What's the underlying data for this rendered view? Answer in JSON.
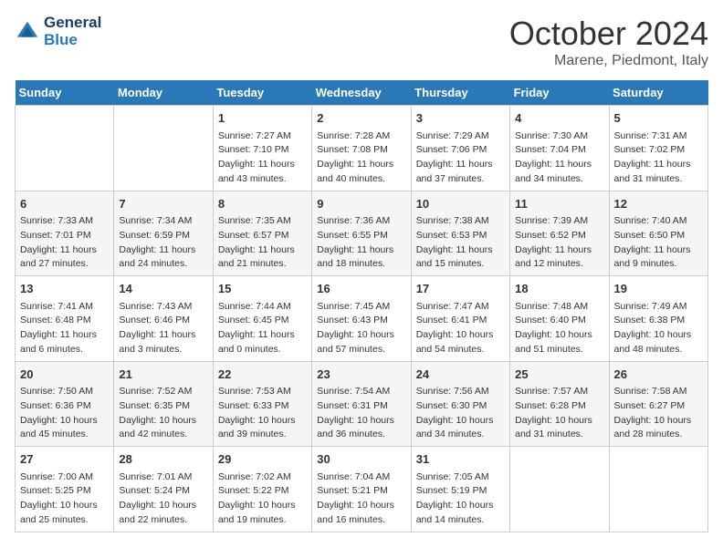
{
  "header": {
    "logo_line1": "General",
    "logo_line2": "Blue",
    "month": "October 2024",
    "location": "Marene, Piedmont, Italy"
  },
  "days_of_week": [
    "Sunday",
    "Monday",
    "Tuesday",
    "Wednesday",
    "Thursday",
    "Friday",
    "Saturday"
  ],
  "weeks": [
    [
      {
        "day": "",
        "info": ""
      },
      {
        "day": "",
        "info": ""
      },
      {
        "day": "1",
        "info": "Sunrise: 7:27 AM\nSunset: 7:10 PM\nDaylight: 11 hours and 43 minutes."
      },
      {
        "day": "2",
        "info": "Sunrise: 7:28 AM\nSunset: 7:08 PM\nDaylight: 11 hours and 40 minutes."
      },
      {
        "day": "3",
        "info": "Sunrise: 7:29 AM\nSunset: 7:06 PM\nDaylight: 11 hours and 37 minutes."
      },
      {
        "day": "4",
        "info": "Sunrise: 7:30 AM\nSunset: 7:04 PM\nDaylight: 11 hours and 34 minutes."
      },
      {
        "day": "5",
        "info": "Sunrise: 7:31 AM\nSunset: 7:02 PM\nDaylight: 11 hours and 31 minutes."
      }
    ],
    [
      {
        "day": "6",
        "info": "Sunrise: 7:33 AM\nSunset: 7:01 PM\nDaylight: 11 hours and 27 minutes."
      },
      {
        "day": "7",
        "info": "Sunrise: 7:34 AM\nSunset: 6:59 PM\nDaylight: 11 hours and 24 minutes."
      },
      {
        "day": "8",
        "info": "Sunrise: 7:35 AM\nSunset: 6:57 PM\nDaylight: 11 hours and 21 minutes."
      },
      {
        "day": "9",
        "info": "Sunrise: 7:36 AM\nSunset: 6:55 PM\nDaylight: 11 hours and 18 minutes."
      },
      {
        "day": "10",
        "info": "Sunrise: 7:38 AM\nSunset: 6:53 PM\nDaylight: 11 hours and 15 minutes."
      },
      {
        "day": "11",
        "info": "Sunrise: 7:39 AM\nSunset: 6:52 PM\nDaylight: 11 hours and 12 minutes."
      },
      {
        "day": "12",
        "info": "Sunrise: 7:40 AM\nSunset: 6:50 PM\nDaylight: 11 hours and 9 minutes."
      }
    ],
    [
      {
        "day": "13",
        "info": "Sunrise: 7:41 AM\nSunset: 6:48 PM\nDaylight: 11 hours and 6 minutes."
      },
      {
        "day": "14",
        "info": "Sunrise: 7:43 AM\nSunset: 6:46 PM\nDaylight: 11 hours and 3 minutes."
      },
      {
        "day": "15",
        "info": "Sunrise: 7:44 AM\nSunset: 6:45 PM\nDaylight: 11 hours and 0 minutes."
      },
      {
        "day": "16",
        "info": "Sunrise: 7:45 AM\nSunset: 6:43 PM\nDaylight: 10 hours and 57 minutes."
      },
      {
        "day": "17",
        "info": "Sunrise: 7:47 AM\nSunset: 6:41 PM\nDaylight: 10 hours and 54 minutes."
      },
      {
        "day": "18",
        "info": "Sunrise: 7:48 AM\nSunset: 6:40 PM\nDaylight: 10 hours and 51 minutes."
      },
      {
        "day": "19",
        "info": "Sunrise: 7:49 AM\nSunset: 6:38 PM\nDaylight: 10 hours and 48 minutes."
      }
    ],
    [
      {
        "day": "20",
        "info": "Sunrise: 7:50 AM\nSunset: 6:36 PM\nDaylight: 10 hours and 45 minutes."
      },
      {
        "day": "21",
        "info": "Sunrise: 7:52 AM\nSunset: 6:35 PM\nDaylight: 10 hours and 42 minutes."
      },
      {
        "day": "22",
        "info": "Sunrise: 7:53 AM\nSunset: 6:33 PM\nDaylight: 10 hours and 39 minutes."
      },
      {
        "day": "23",
        "info": "Sunrise: 7:54 AM\nSunset: 6:31 PM\nDaylight: 10 hours and 36 minutes."
      },
      {
        "day": "24",
        "info": "Sunrise: 7:56 AM\nSunset: 6:30 PM\nDaylight: 10 hours and 34 minutes."
      },
      {
        "day": "25",
        "info": "Sunrise: 7:57 AM\nSunset: 6:28 PM\nDaylight: 10 hours and 31 minutes."
      },
      {
        "day": "26",
        "info": "Sunrise: 7:58 AM\nSunset: 6:27 PM\nDaylight: 10 hours and 28 minutes."
      }
    ],
    [
      {
        "day": "27",
        "info": "Sunrise: 7:00 AM\nSunset: 5:25 PM\nDaylight: 10 hours and 25 minutes."
      },
      {
        "day": "28",
        "info": "Sunrise: 7:01 AM\nSunset: 5:24 PM\nDaylight: 10 hours and 22 minutes."
      },
      {
        "day": "29",
        "info": "Sunrise: 7:02 AM\nSunset: 5:22 PM\nDaylight: 10 hours and 19 minutes."
      },
      {
        "day": "30",
        "info": "Sunrise: 7:04 AM\nSunset: 5:21 PM\nDaylight: 10 hours and 16 minutes."
      },
      {
        "day": "31",
        "info": "Sunrise: 7:05 AM\nSunset: 5:19 PM\nDaylight: 10 hours and 14 minutes."
      },
      {
        "day": "",
        "info": ""
      },
      {
        "day": "",
        "info": ""
      }
    ]
  ]
}
